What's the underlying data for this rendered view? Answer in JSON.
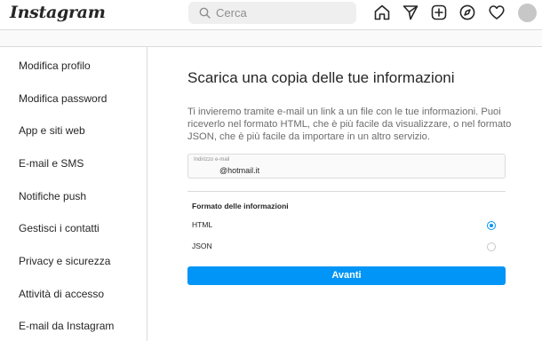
{
  "header": {
    "logo": "Instagram",
    "search": {
      "placeholder": "Cerca"
    },
    "icons": [
      "home-icon",
      "direct-icon",
      "new-post-icon",
      "explore-icon",
      "activity-icon",
      "profile-avatar"
    ]
  },
  "sidebar": {
    "items": [
      {
        "label": "Modifica profilo"
      },
      {
        "label": "Modifica password"
      },
      {
        "label": "App e siti web"
      },
      {
        "label": "E-mail e SMS"
      },
      {
        "label": "Notifiche push"
      },
      {
        "label": "Gestisci i contatti"
      },
      {
        "label": "Privacy e sicurezza"
      },
      {
        "label": "Attività di accesso"
      },
      {
        "label": "E-mail da Instagram"
      }
    ]
  },
  "main": {
    "title": "Scarica una copia delle tue informazioni",
    "description": "Ti invieremo tramite e-mail un link a un file con le tue informazioni. Puoi riceverlo nel formato HTML, che è più facile da visualizzare, o nel formato JSON, che è più facile da importare in un altro servizio.",
    "email": {
      "label": "Indirizzo e-mail",
      "value": "@hotmail.it"
    },
    "format": {
      "heading": "Formato delle informazioni",
      "options": [
        {
          "label": "HTML",
          "selected": true
        },
        {
          "label": "JSON",
          "selected": false
        }
      ]
    },
    "submit_label": "Avanti"
  },
  "colors": {
    "accent": "#0095f6",
    "border": "#dbdbdb",
    "muted_text": "#6d6d6d"
  }
}
